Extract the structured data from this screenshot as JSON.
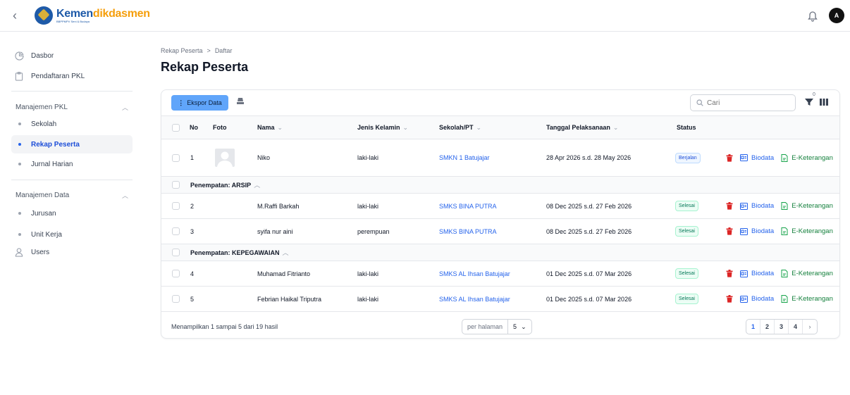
{
  "app": {
    "logo_primary": "Kemen",
    "logo_secondary": "dikdasmen",
    "logo_sub": "BBPPMPV Seni & Budaya",
    "user_initial": "A"
  },
  "sidebar": {
    "items": [
      {
        "label": "Dasbor",
        "icon": "pie-chart-icon"
      },
      {
        "label": "Pendaftaran PKL",
        "icon": "clipboard-icon"
      }
    ],
    "groups": [
      {
        "label": "Manajemen PKL",
        "items": [
          "Sekolah",
          "Rekap Peserta",
          "Jurnal Harian"
        ]
      },
      {
        "label": "Manajemen Data",
        "items": [
          "Jurusan",
          "Unit Kerja"
        ]
      }
    ],
    "users_label": "Users",
    "active": "Rekap Peserta"
  },
  "breadcrumb": {
    "root": "Rekap Peserta",
    "sep": ">",
    "current": "Daftar"
  },
  "page_title": "Rekap Peserta",
  "toolbar": {
    "export_label": "Ekspor Data",
    "search_placeholder": "Cari",
    "filter_count": "0"
  },
  "table": {
    "headers": {
      "no": "No",
      "foto": "Foto",
      "nama": "Nama",
      "jenis_kelamin": "Jenis Kelamin",
      "sekolah": "Sekolah/PT",
      "tanggal": "Tanggal Pelaksanaan",
      "status": "Status"
    },
    "actions": {
      "biodata": "Biodata",
      "keterangan": "E-Keterangan"
    },
    "rows": [
      {
        "no": "1",
        "nama": "Niko",
        "jk": "laki-laki",
        "sekolah": "SMKN 1 Batujajar",
        "tanggal": "28 Apr 2026 s.d. 28 May 2026",
        "status": "Berjalan"
      },
      {
        "no": "2",
        "nama": "M.Raffi Barkah",
        "jk": "laki-laki",
        "sekolah": "SMKS BINA PUTRA",
        "tanggal": "08 Dec 2025 s.d. 27 Feb 2026",
        "status": "Selesai"
      },
      {
        "no": "3",
        "nama": "syifa nur aini",
        "jk": "perempuan",
        "sekolah": "SMKS BINA PUTRA",
        "tanggal": "08 Dec 2025 s.d. 27 Feb 2026",
        "status": "Selesai"
      },
      {
        "no": "4",
        "nama": "Muhamad Fitrianto",
        "jk": "laki-laki",
        "sekolah": "SMKS AL Ihsan Batujajar",
        "tanggal": "01 Dec 2025 s.d. 07 Mar 2026",
        "status": "Selesai"
      },
      {
        "no": "5",
        "nama": "Febrian Haikal Triputra",
        "jk": "laki-laki",
        "sekolah": "SMKS AL Ihsan Batujajar",
        "tanggal": "01 Dec 2025 s.d. 07 Mar 2026",
        "status": "Selesai"
      }
    ],
    "groups": [
      "Penempatan: ARSIP",
      "Penempatan: KEPEGAWAIAN"
    ]
  },
  "footer": {
    "summary": "Menampilkan 1 sampai 5 dari 19 hasil",
    "per_page_label": "per halaman",
    "per_page_value": "5",
    "pages": [
      "1",
      "2",
      "3",
      "4"
    ],
    "next": "›"
  }
}
